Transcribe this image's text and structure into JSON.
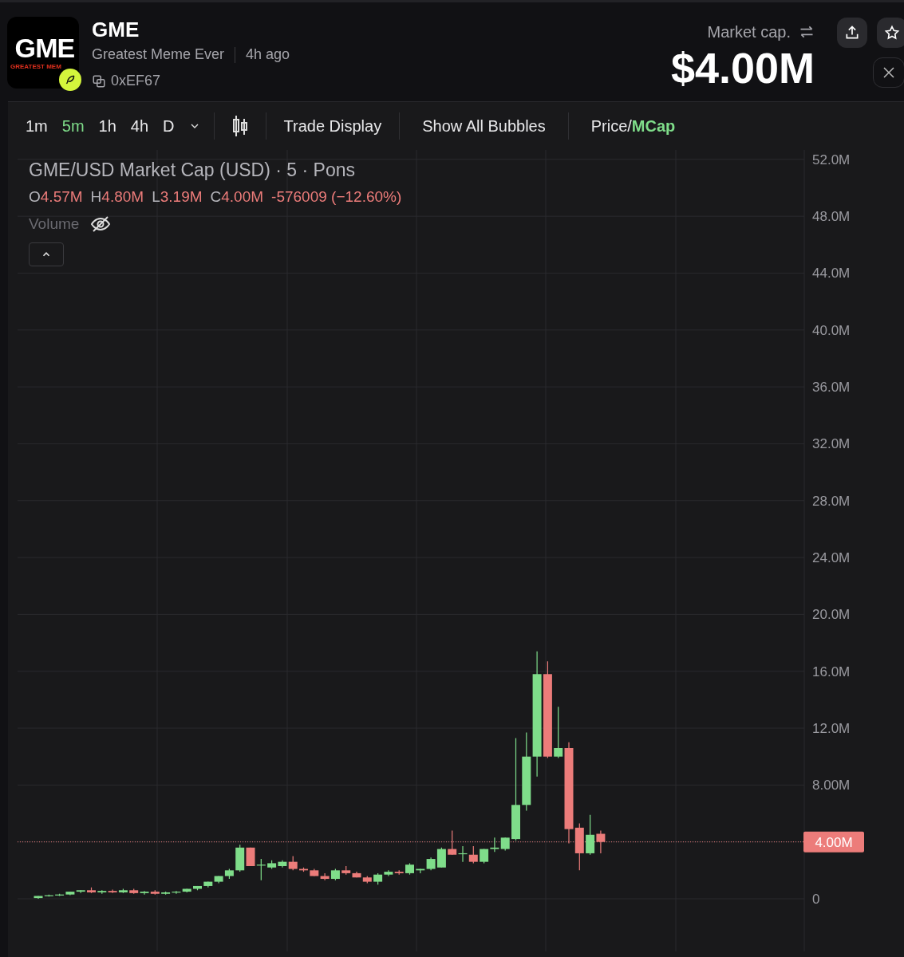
{
  "token": {
    "logo": {
      "title": "GME",
      "subtitle": "GREATEST MEM"
    },
    "symbol": "GME",
    "name": "Greatest Meme Ever",
    "age": "4h ago",
    "address": "0xEF67"
  },
  "market_cap": {
    "label": "Market cap.",
    "value": "$4.00M"
  },
  "toolbar": {
    "intervals": [
      {
        "label": "1m",
        "selected": false
      },
      {
        "label": "5m",
        "selected": true
      },
      {
        "label": "1h",
        "selected": false
      },
      {
        "label": "4h",
        "selected": false
      },
      {
        "label": "D",
        "selected": false
      }
    ],
    "buttons": [
      "Trade Display",
      "Show All Bubbles"
    ],
    "price_toggle": {
      "left": "Price/",
      "right": "MCap"
    }
  },
  "chart": {
    "legend": {
      "title": "GME/USD Market Cap (USD) · 5 · Pons",
      "ohlc": [
        {
          "key": "O",
          "value": "4.57M"
        },
        {
          "key": "H",
          "value": "4.80M"
        },
        {
          "key": "L",
          "value": "3.19M"
        },
        {
          "key": "C",
          "value": "4.00M"
        }
      ],
      "change": "-576009 (−12.60%)",
      "volume_label": "Volume"
    },
    "price_label": "4.00M",
    "axis_labels": [
      "52.0M",
      "48.0M",
      "44.0M",
      "40.0M",
      "36.0M",
      "32.0M",
      "28.0M",
      "24.0M",
      "20.0M",
      "16.0M",
      "12.0M",
      "8.00M",
      "0"
    ]
  }
}
